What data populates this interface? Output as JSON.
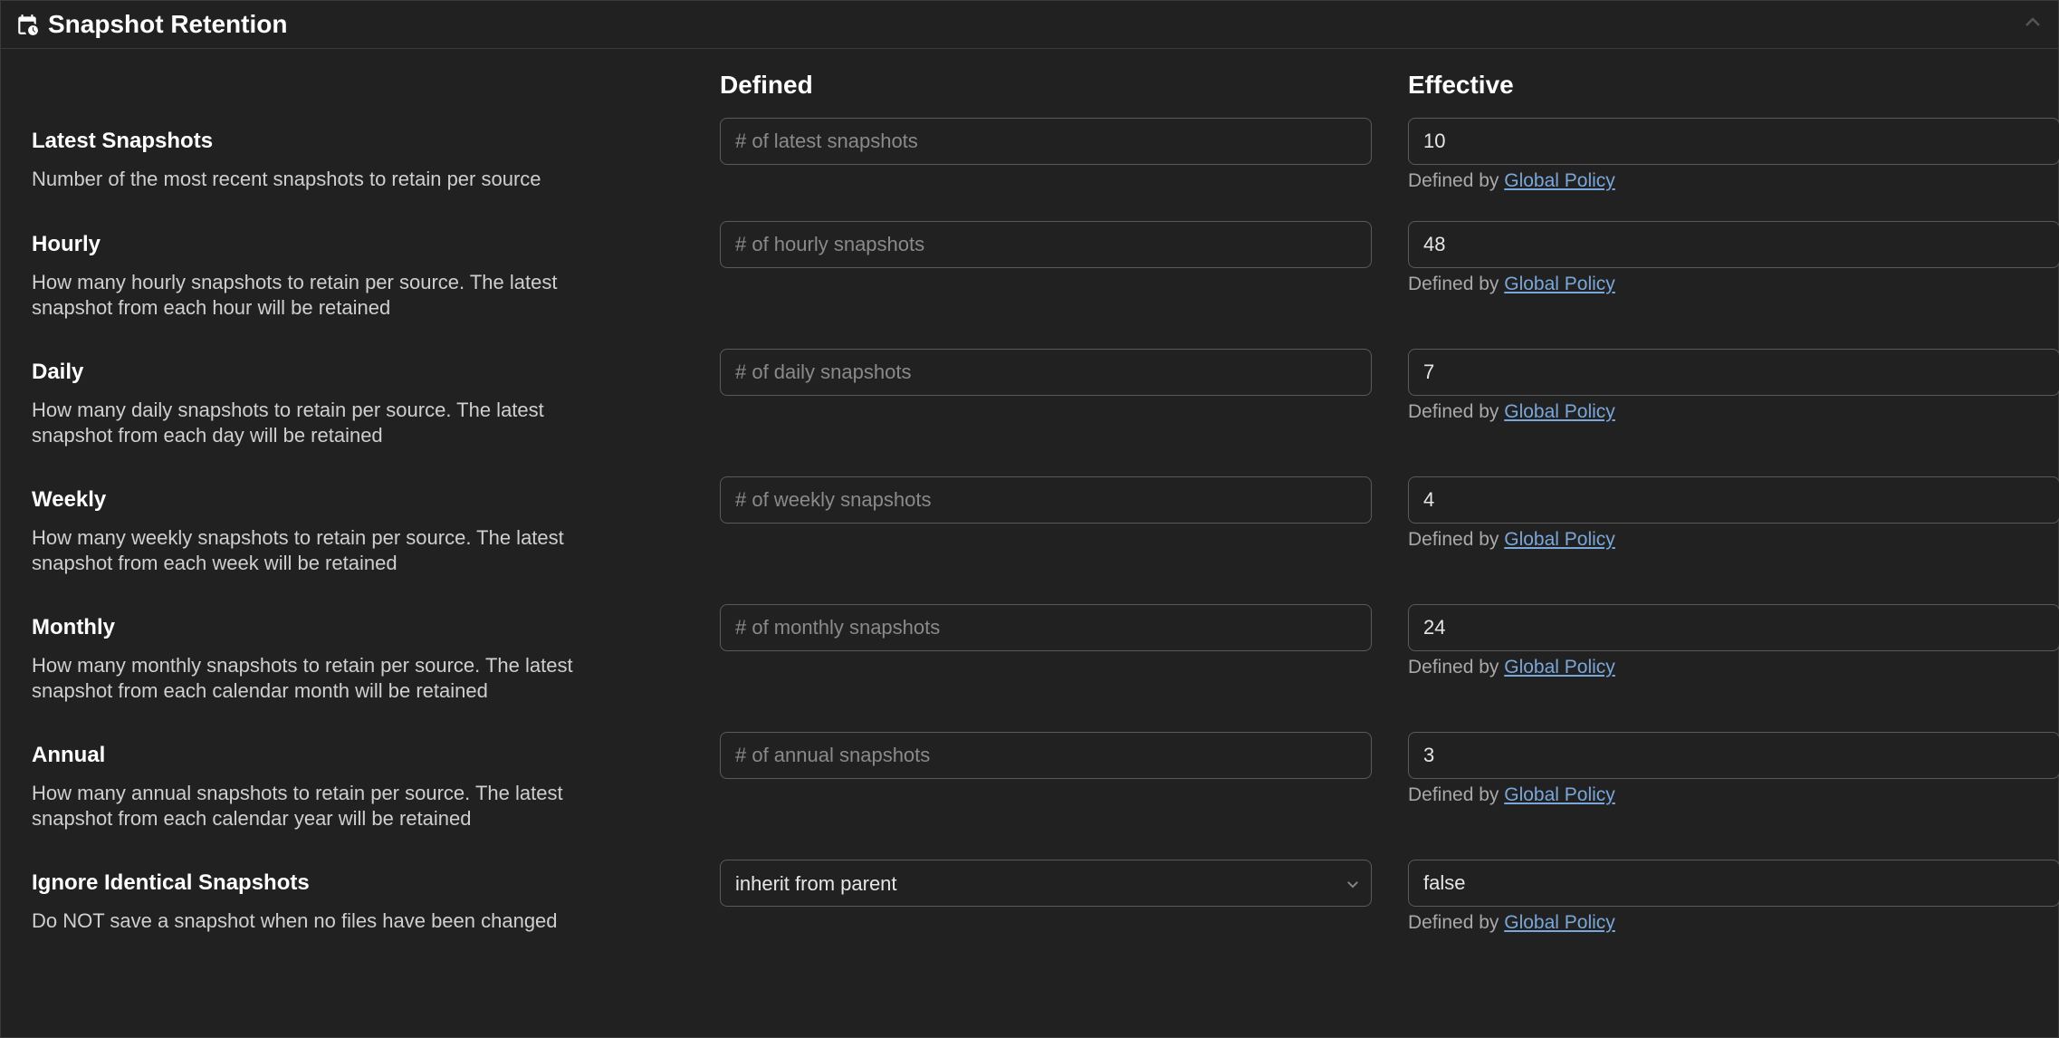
{
  "header": {
    "title": "Snapshot Retention"
  },
  "columns": {
    "defined": "Defined",
    "effective": "Effective"
  },
  "definedByPrefix": "Defined by ",
  "policyLink": "Global Policy",
  "rows": {
    "latest": {
      "label": "Latest Snapshots",
      "desc": "Number of the most recent snapshots to retain per source",
      "placeholder": "# of latest snapshots",
      "effective": "10"
    },
    "hourly": {
      "label": "Hourly",
      "desc": "How many hourly snapshots to retain per source. The latest snapshot from each hour will be retained",
      "placeholder": "# of hourly snapshots",
      "effective": "48"
    },
    "daily": {
      "label": "Daily",
      "desc": "How many daily snapshots to retain per source. The latest snapshot from each day will be retained",
      "placeholder": "# of daily snapshots",
      "effective": "7"
    },
    "weekly": {
      "label": "Weekly",
      "desc": "How many weekly snapshots to retain per source. The latest snapshot from each week will be retained",
      "placeholder": "# of weekly snapshots",
      "effective": "4"
    },
    "monthly": {
      "label": "Monthly",
      "desc": "How many monthly snapshots to retain per source. The latest snapshot from each calendar month will be retained",
      "placeholder": "# of monthly snapshots",
      "effective": "24"
    },
    "annual": {
      "label": "Annual",
      "desc": "How many annual snapshots to retain per source. The latest snapshot from each calendar year will be retained",
      "placeholder": "# of annual snapshots",
      "effective": "3"
    },
    "ignore": {
      "label": "Ignore Identical Snapshots",
      "desc": "Do NOT save a snapshot when no files have been changed",
      "selected": "inherit from parent",
      "effective": "false"
    }
  }
}
